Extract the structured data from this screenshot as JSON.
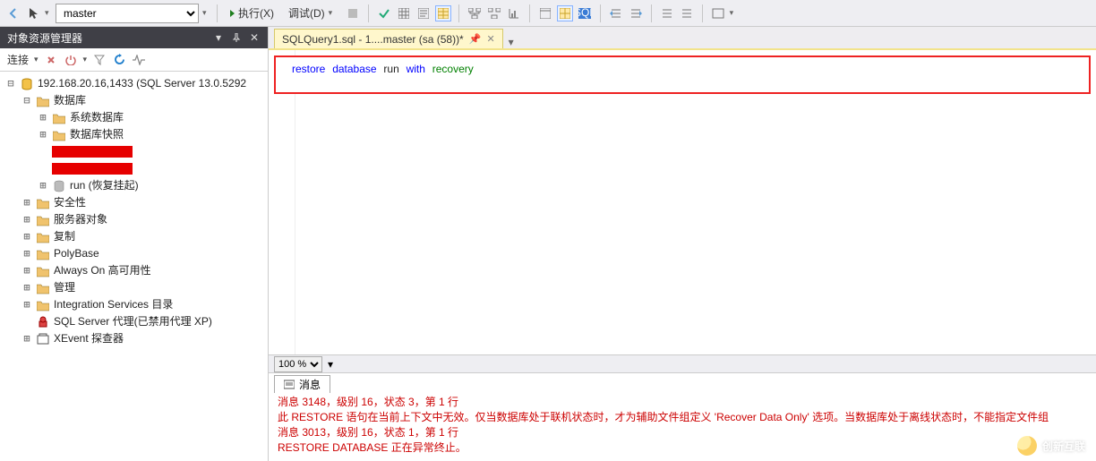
{
  "toolbar": {
    "branch_dropdown": "master",
    "execute_label": "执行(X)",
    "debug_label": "调试(D)"
  },
  "explorer": {
    "panel_title": "对象资源管理器",
    "connect_label": "连接",
    "server": {
      "label": "192.168.20.16,1433 (SQL Server 13.0.5292",
      "children": {
        "databases": {
          "label": "数据库",
          "sysdb": "系统数据库",
          "snapshots": "数据库快照",
          "run": {
            "label": "run (恢复挂起)"
          }
        },
        "security": "安全性",
        "server_objects": "服务器对象",
        "replication": "复制",
        "polybase": "PolyBase",
        "always_on": "Always On 高可用性",
        "management": "管理",
        "integration": "Integration Services 目录",
        "agent": "SQL Server 代理(已禁用代理 XP)",
        "xevent": "XEvent 探查器"
      }
    }
  },
  "editor": {
    "tab_label": "SQLQuery1.sql - 1....master (sa (58))*",
    "code": {
      "kw1": "restore",
      "kw2": "database",
      "id": "run",
      "kw3": "with",
      "kw4": "recovery"
    },
    "zoom": "100 %",
    "messages_tab": "消息",
    "messages": [
      "消息 3148，级别 16，状态 3，第 1 行",
      "此 RESTORE 语句在当前上下文中无效。仅当数据库处于联机状态时，才为辅助文件组定义 'Recover Data Only' 选项。当数据库处于离线状态时，不能指定文件组",
      "消息 3013，级别 16，状态 1，第 1 行",
      "RESTORE DATABASE 正在异常终止。"
    ]
  },
  "watermark": "创新互联"
}
